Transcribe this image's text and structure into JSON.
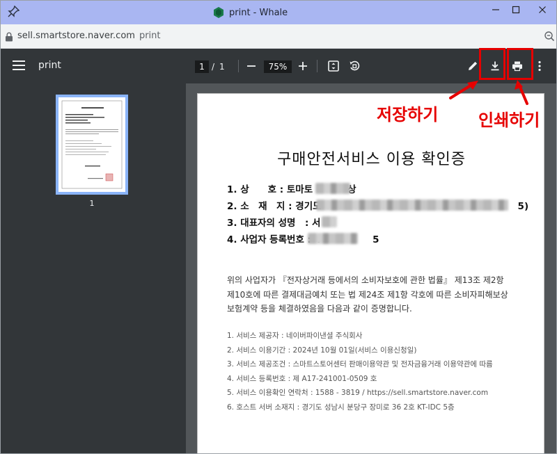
{
  "window": {
    "title": "print - Whale",
    "controls": {
      "minimize": "minimize",
      "maximize": "maximize",
      "close": "close"
    }
  },
  "address": {
    "host": "sell.smartstore.naver.com",
    "path": "print"
  },
  "pdf_toolbar": {
    "doc_title": "print",
    "page_current": "1",
    "page_sep": "/",
    "page_total": "1",
    "zoom": "75%"
  },
  "sidebar": {
    "thumb_page_num": "1"
  },
  "document": {
    "heading": "구매안전서비스 이용 확인증",
    "fields": [
      {
        "label": "1. 상　　호 : 토마토",
        "tail": "상"
      },
      {
        "label": "2. 소　재　지 : 경기도",
        "tail": "5)"
      },
      {
        "label": "3. 대표자의 성명　: 서",
        "tail": ""
      },
      {
        "label": "4. 사업자 등록번호 : 4",
        "tail": "5"
      }
    ],
    "paragraph": [
      "위의 사업자가 『전자상거래 등에서의 소비자보호에 관한 법률』 제13조 제2항",
      "제10호에 따른 결제대금예치 또는 법 제24조 제1항 각호에 따른 소비자피해보상",
      "보험계약 등을 체결하였음을 다음과 같이 증명합니다."
    ],
    "info": [
      "1. 서비스 제공자 : 네이버파이낸셜 주식회사",
      "2. 서비스 이용기간 : 2024년 10월 01일(서비스 이용신청일)",
      "3. 서비스 제공조건 : 스마트스토어센터 판매이용약관 및 전자금융거래 이용약관에 따름",
      "4. 서비스 등록번호 : 제 A17-241001-0509 호",
      "5. 서비스 이용확인 연락처 : 1588 - 3819 / https://sell.smartstore.naver.com",
      "6. 호스트 서버 소재지 : 경기도 성남시 분당구 장미로 36 2호 KT-IDC 5층"
    ]
  },
  "annotations": {
    "download": "저장하기",
    "print": "인쇄하기"
  },
  "colors": {
    "titlebar": "#a9b6f2",
    "toolbar": "#323639",
    "viewer": "#525659",
    "annotation": "#e60000",
    "thumb_border": "#8ab4f8"
  },
  "icons": [
    "pin-icon",
    "whale-logo-icon",
    "lock-icon",
    "zoom-icon",
    "menu-icon",
    "minus-icon",
    "plus-icon",
    "fit-page-icon",
    "rotate-icon",
    "pen-icon",
    "download-icon",
    "print-icon",
    "more-icon"
  ]
}
